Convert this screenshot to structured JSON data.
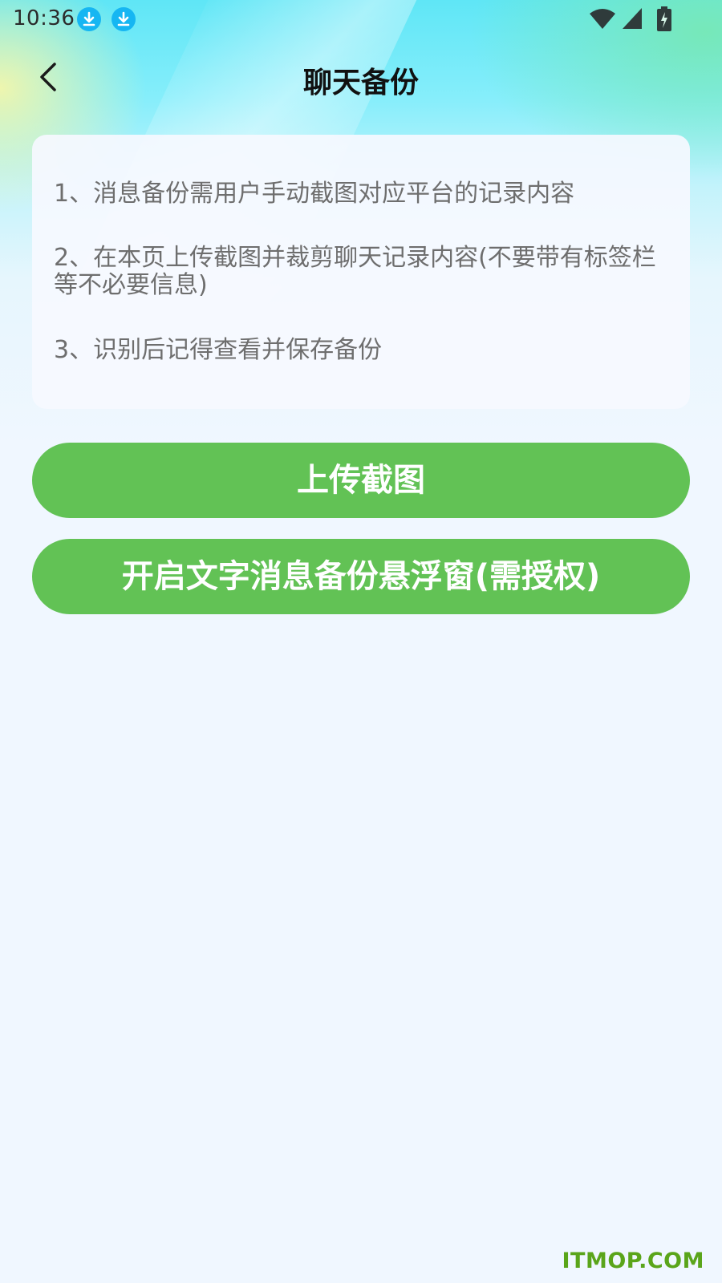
{
  "status_bar": {
    "time": "10:36",
    "icons": [
      "download-icon",
      "download-icon",
      "wifi-icon",
      "signal-icon",
      "battery-charging-icon"
    ]
  },
  "header": {
    "back_icon": "chevron-left-icon",
    "title": "聊天备份"
  },
  "instructions": [
    "1、消息备份需用户手动截图对应平台的记录内容",
    "2、在本页上传截图并裁剪聊天记录内容(不要带有标签栏等不必要信息)",
    "3、识别后记得查看并保存备份"
  ],
  "buttons": {
    "upload_label": "上传截图",
    "float_window_label": "开启文字消息备份悬浮窗(需授权)"
  },
  "watermark": "ITMOP.COM",
  "colors": {
    "accent_green": "#62c255",
    "download_badge": "#16b6f2",
    "page_background": "#f0f7ff"
  }
}
